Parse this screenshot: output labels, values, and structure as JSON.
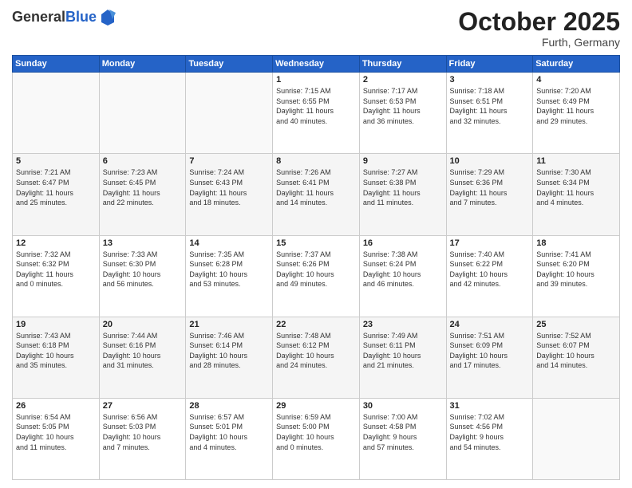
{
  "logo": {
    "general": "General",
    "blue": "Blue"
  },
  "header": {
    "month": "October 2025",
    "location": "Furth, Germany"
  },
  "weekdays": [
    "Sunday",
    "Monday",
    "Tuesday",
    "Wednesday",
    "Thursday",
    "Friday",
    "Saturday"
  ],
  "weeks": [
    [
      {
        "day": "",
        "content": ""
      },
      {
        "day": "",
        "content": ""
      },
      {
        "day": "",
        "content": ""
      },
      {
        "day": "1",
        "content": "Sunrise: 7:15 AM\nSunset: 6:55 PM\nDaylight: 11 hours\nand 40 minutes."
      },
      {
        "day": "2",
        "content": "Sunrise: 7:17 AM\nSunset: 6:53 PM\nDaylight: 11 hours\nand 36 minutes."
      },
      {
        "day": "3",
        "content": "Sunrise: 7:18 AM\nSunset: 6:51 PM\nDaylight: 11 hours\nand 32 minutes."
      },
      {
        "day": "4",
        "content": "Sunrise: 7:20 AM\nSunset: 6:49 PM\nDaylight: 11 hours\nand 29 minutes."
      }
    ],
    [
      {
        "day": "5",
        "content": "Sunrise: 7:21 AM\nSunset: 6:47 PM\nDaylight: 11 hours\nand 25 minutes."
      },
      {
        "day": "6",
        "content": "Sunrise: 7:23 AM\nSunset: 6:45 PM\nDaylight: 11 hours\nand 22 minutes."
      },
      {
        "day": "7",
        "content": "Sunrise: 7:24 AM\nSunset: 6:43 PM\nDaylight: 11 hours\nand 18 minutes."
      },
      {
        "day": "8",
        "content": "Sunrise: 7:26 AM\nSunset: 6:41 PM\nDaylight: 11 hours\nand 14 minutes."
      },
      {
        "day": "9",
        "content": "Sunrise: 7:27 AM\nSunset: 6:38 PM\nDaylight: 11 hours\nand 11 minutes."
      },
      {
        "day": "10",
        "content": "Sunrise: 7:29 AM\nSunset: 6:36 PM\nDaylight: 11 hours\nand 7 minutes."
      },
      {
        "day": "11",
        "content": "Sunrise: 7:30 AM\nSunset: 6:34 PM\nDaylight: 11 hours\nand 4 minutes."
      }
    ],
    [
      {
        "day": "12",
        "content": "Sunrise: 7:32 AM\nSunset: 6:32 PM\nDaylight: 11 hours\nand 0 minutes."
      },
      {
        "day": "13",
        "content": "Sunrise: 7:33 AM\nSunset: 6:30 PM\nDaylight: 10 hours\nand 56 minutes."
      },
      {
        "day": "14",
        "content": "Sunrise: 7:35 AM\nSunset: 6:28 PM\nDaylight: 10 hours\nand 53 minutes."
      },
      {
        "day": "15",
        "content": "Sunrise: 7:37 AM\nSunset: 6:26 PM\nDaylight: 10 hours\nand 49 minutes."
      },
      {
        "day": "16",
        "content": "Sunrise: 7:38 AM\nSunset: 6:24 PM\nDaylight: 10 hours\nand 46 minutes."
      },
      {
        "day": "17",
        "content": "Sunrise: 7:40 AM\nSunset: 6:22 PM\nDaylight: 10 hours\nand 42 minutes."
      },
      {
        "day": "18",
        "content": "Sunrise: 7:41 AM\nSunset: 6:20 PM\nDaylight: 10 hours\nand 39 minutes."
      }
    ],
    [
      {
        "day": "19",
        "content": "Sunrise: 7:43 AM\nSunset: 6:18 PM\nDaylight: 10 hours\nand 35 minutes."
      },
      {
        "day": "20",
        "content": "Sunrise: 7:44 AM\nSunset: 6:16 PM\nDaylight: 10 hours\nand 31 minutes."
      },
      {
        "day": "21",
        "content": "Sunrise: 7:46 AM\nSunset: 6:14 PM\nDaylight: 10 hours\nand 28 minutes."
      },
      {
        "day": "22",
        "content": "Sunrise: 7:48 AM\nSunset: 6:12 PM\nDaylight: 10 hours\nand 24 minutes."
      },
      {
        "day": "23",
        "content": "Sunrise: 7:49 AM\nSunset: 6:11 PM\nDaylight: 10 hours\nand 21 minutes."
      },
      {
        "day": "24",
        "content": "Sunrise: 7:51 AM\nSunset: 6:09 PM\nDaylight: 10 hours\nand 17 minutes."
      },
      {
        "day": "25",
        "content": "Sunrise: 7:52 AM\nSunset: 6:07 PM\nDaylight: 10 hours\nand 14 minutes."
      }
    ],
    [
      {
        "day": "26",
        "content": "Sunrise: 6:54 AM\nSunset: 5:05 PM\nDaylight: 10 hours\nand 11 minutes."
      },
      {
        "day": "27",
        "content": "Sunrise: 6:56 AM\nSunset: 5:03 PM\nDaylight: 10 hours\nand 7 minutes."
      },
      {
        "day": "28",
        "content": "Sunrise: 6:57 AM\nSunset: 5:01 PM\nDaylight: 10 hours\nand 4 minutes."
      },
      {
        "day": "29",
        "content": "Sunrise: 6:59 AM\nSunset: 5:00 PM\nDaylight: 10 hours\nand 0 minutes."
      },
      {
        "day": "30",
        "content": "Sunrise: 7:00 AM\nSunset: 4:58 PM\nDaylight: 9 hours\nand 57 minutes."
      },
      {
        "day": "31",
        "content": "Sunrise: 7:02 AM\nSunset: 4:56 PM\nDaylight: 9 hours\nand 54 minutes."
      },
      {
        "day": "",
        "content": ""
      }
    ]
  ]
}
